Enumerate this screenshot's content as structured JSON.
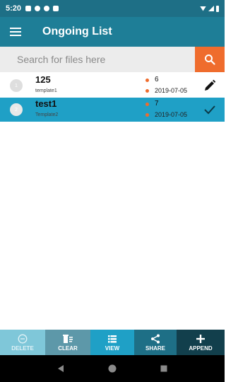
{
  "status_bar": {
    "time": "5:20"
  },
  "app_bar": {
    "title": "Ongoing List",
    "menu_icon": "hamburger-icon"
  },
  "search": {
    "placeholder": "Search for files here",
    "value": "",
    "icon": "search-icon"
  },
  "list": {
    "rows": [
      {
        "index": "1",
        "title": "125",
        "template": "template1",
        "count": "6",
        "date": "2019-07-05",
        "selected": false,
        "action_icon": "pencil-icon"
      },
      {
        "index": "2",
        "title": "test1",
        "template": "Template2",
        "count": "7",
        "date": "2019-07-05",
        "selected": true,
        "action_icon": "check-icon"
      }
    ]
  },
  "bottom_bar": {
    "delete": "DELETE",
    "clear": "CLEAR",
    "view": "VIEW",
    "share": "SHARE",
    "append": "APPEND"
  },
  "colors": {
    "status_bar": "#1e6f86",
    "app_bar": "#1e7e97",
    "accent": "#ef6c2d",
    "selected_row": "#1fa0c6"
  }
}
